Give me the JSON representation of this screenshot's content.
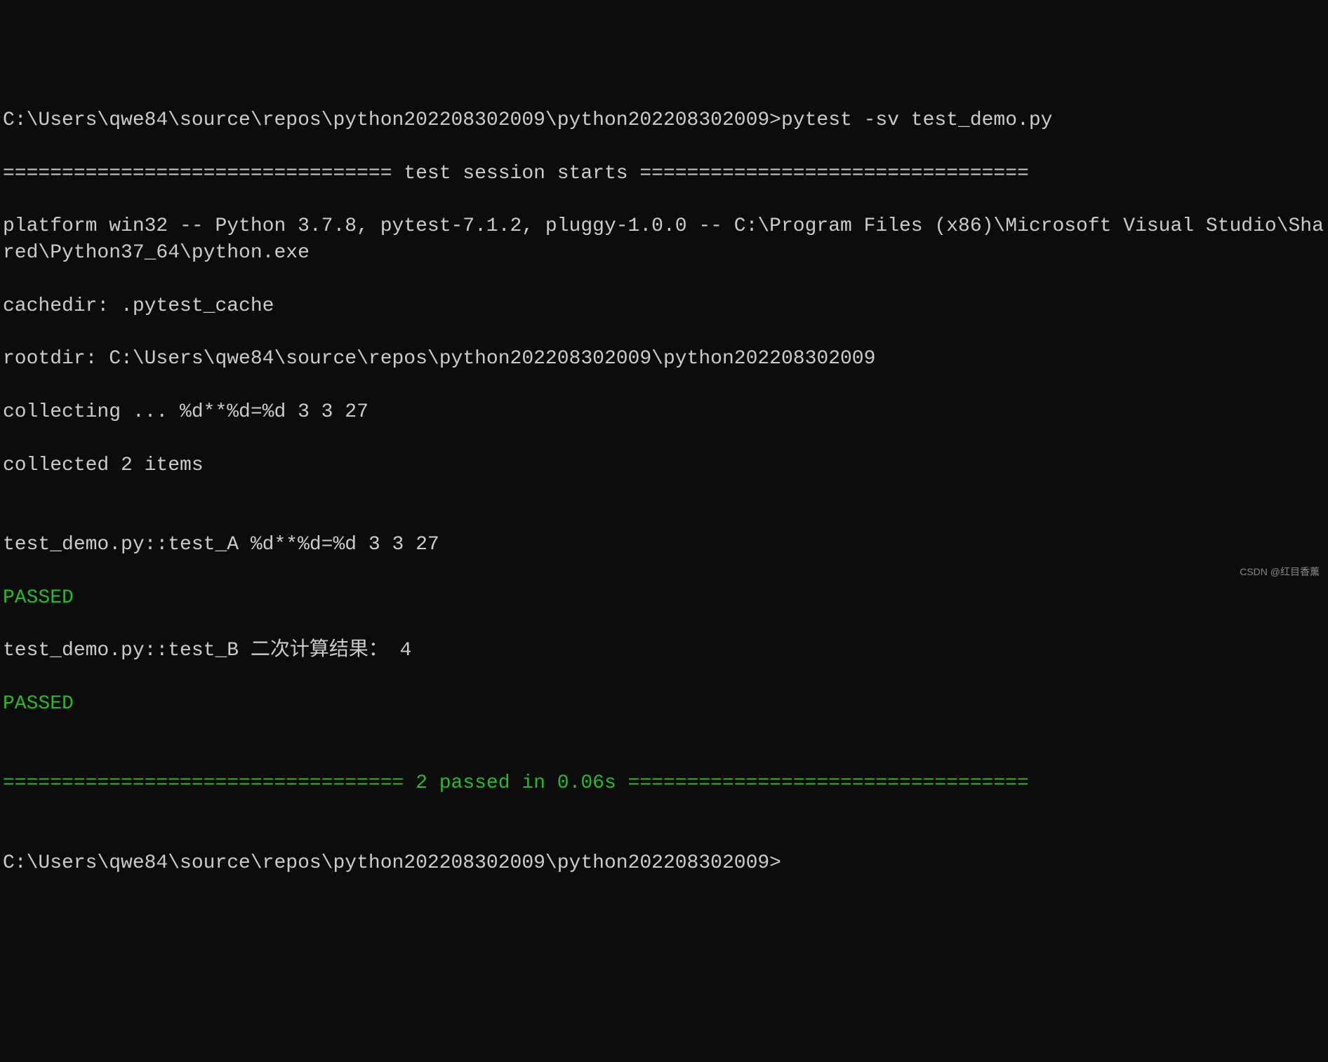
{
  "terminal": {
    "prompt1": "C:\\Users\\qwe84\\source\\repos\\python202208302009\\python202208302009>pytest -sv test_demo.py",
    "session_header": "================================= test session starts =================================",
    "platform": "platform win32 -- Python 3.7.8, pytest-7.1.2, pluggy-1.0.0 -- C:\\Program Files (x86)\\Microsoft Visual Studio\\Shared\\Python37_64\\python.exe",
    "cachedir": "cachedir: .pytest_cache",
    "rootdir": "rootdir: C:\\Users\\qwe84\\source\\repos\\python202208302009\\python202208302009",
    "collecting": "collecting ... %d**%d=%d 3 3 27",
    "collected": "collected 2 items",
    "blank": "",
    "test_a": "test_demo.py::test_A %d**%d=%d 3 3 27",
    "passed_a": "PASSED",
    "test_b": "test_demo.py::test_B 二次计算结果： 4",
    "passed_b": "PASSED",
    "summary": "================================== 2 passed in 0.06s ==================================",
    "prompt2": "C:\\Users\\qwe84\\source\\repos\\python202208302009\\python202208302009>",
    "watermark": "CSDN @红目香薰"
  }
}
